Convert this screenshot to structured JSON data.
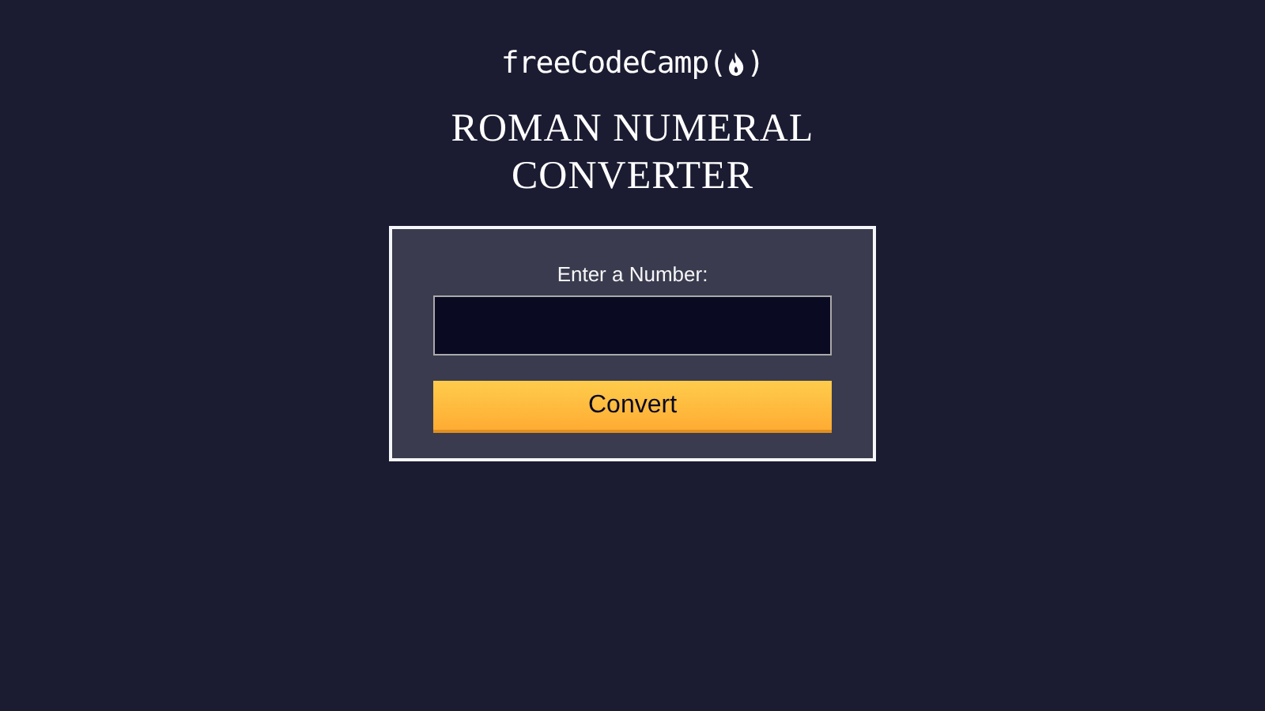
{
  "logo": {
    "name": "freeCodeCamp",
    "open": "(",
    "close": ")"
  },
  "title": "ROMAN NUMERAL CONVERTER",
  "form": {
    "label": "Enter a Number:",
    "button": "Convert"
  }
}
